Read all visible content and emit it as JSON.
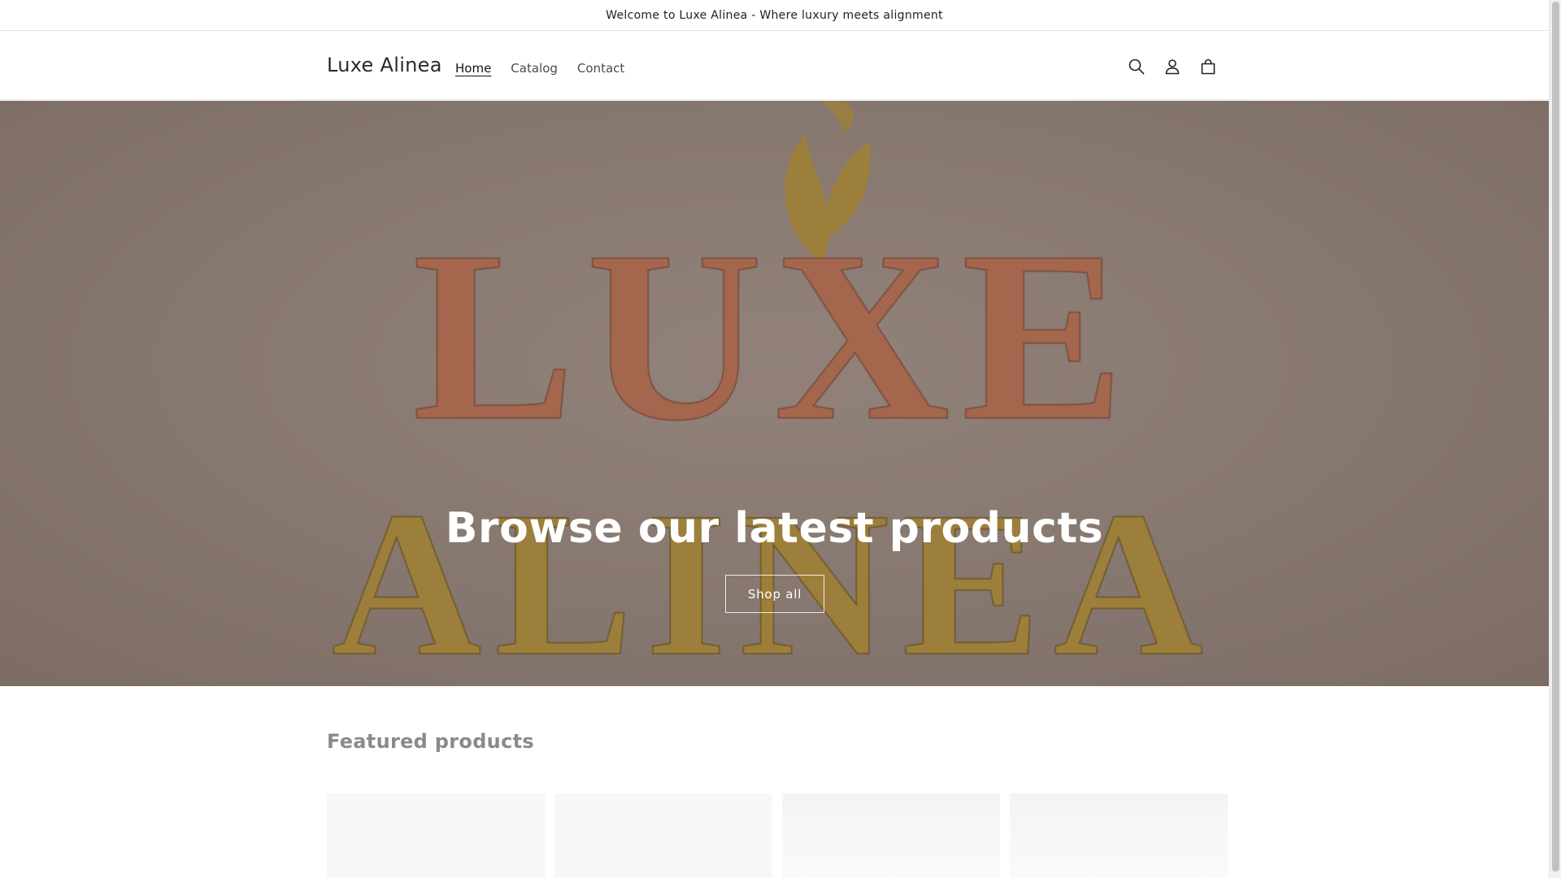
{
  "announcement": {
    "text": "Welcome to Luxe Alinea - Where luxury meets alignment"
  },
  "header": {
    "logo": "Luxe Alinea",
    "nav": [
      {
        "label": "Home",
        "active": true
      },
      {
        "label": "Catalog",
        "active": false
      },
      {
        "label": "Contact",
        "active": false
      }
    ],
    "icons": [
      "search-icon",
      "account-icon",
      "cart-icon"
    ]
  },
  "hero": {
    "logo_text_line1": "LUXE",
    "logo_text_line2": "ALINEA",
    "title": "Browse our latest products",
    "button_label": "Shop all",
    "colors": {
      "background": "#8f7f77",
      "copper": "#b06d53",
      "gold": "#a7873f"
    }
  },
  "featured": {
    "title": "Featured products"
  }
}
